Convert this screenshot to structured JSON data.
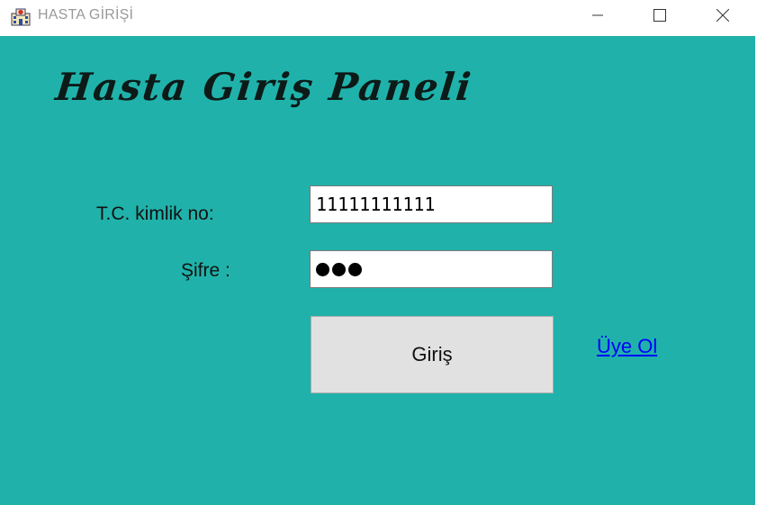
{
  "window": {
    "title": "HASTA GİRİŞİ",
    "icon": "hospital-icon",
    "controls": [
      "minimize-icon",
      "maximize-icon",
      "close-icon"
    ]
  },
  "panel": {
    "heading": "Hasta Giriş Paneli"
  },
  "form": {
    "tc_label": "T.C. kimlik no:",
    "tc_value": "11111111111",
    "password_label": "Şifre :",
    "password_mask_count": 3
  },
  "actions": {
    "login_label": "Giriş",
    "register_link": "Üye Ol"
  },
  "colors": {
    "background": "#20b2aa",
    "button": "#e1e1e1",
    "link": "#0000ff"
  }
}
